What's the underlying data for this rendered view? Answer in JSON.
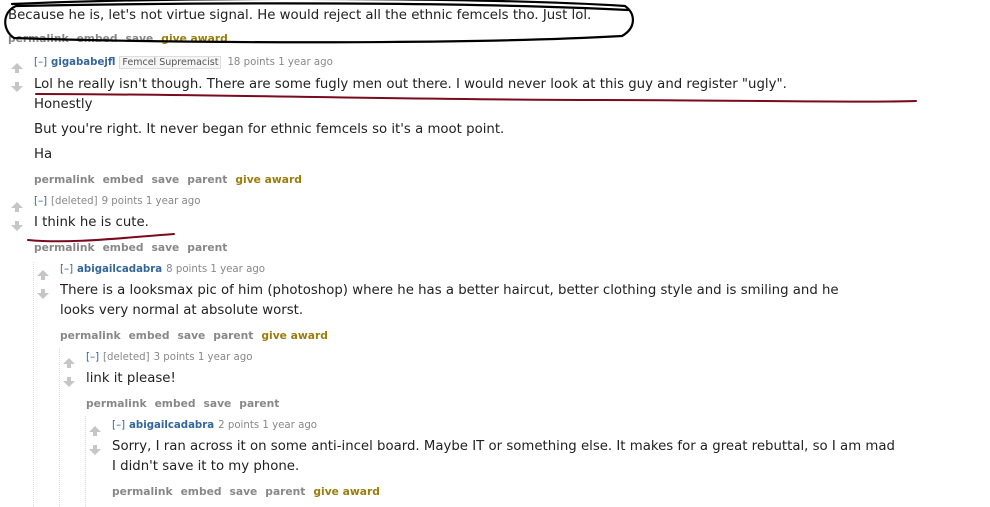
{
  "top_comment": {
    "text": "Because he is, let's not virtue signal. He would reject all the ethnic femcels tho. Just lol.",
    "buttons": [
      "permalink",
      "embed",
      "save",
      "give award"
    ]
  },
  "comments": [
    {
      "expand": "[–]",
      "author": "gigababejfl",
      "flair": "Femcel Supremacist",
      "points": "18 points",
      "time": "1 year ago",
      "lines": [
        "Lol he really isn't though. There are some fugly men out there. I would never look at this guy and register \"ugly\".",
        "Honestly",
        "But you're right. It never began for ethnic femcels so it's a moot point.",
        "Ha"
      ],
      "buttons": [
        "permalink",
        "embed",
        "save",
        "parent",
        "give award"
      ]
    },
    {
      "expand": "[–]",
      "author": "[deleted]",
      "points": "9 points",
      "time": "1 year ago",
      "lines": [
        "I think he is cute."
      ],
      "buttons": [
        "permalink",
        "embed",
        "save",
        "parent"
      ]
    },
    {
      "expand": "[–]",
      "author": "abigailcadabra",
      "points": "8 points",
      "time": "1 year ago",
      "lines": [
        "There is a looksmax pic of him (photoshop) where he has a better haircut, better clothing style and is smiling and he",
        "looks very normal at absolute worst."
      ],
      "buttons": [
        "permalink",
        "embed",
        "save",
        "parent",
        "give award"
      ]
    },
    {
      "expand": "[–]",
      "author": "[deleted]",
      "points": "3 points",
      "time": "1 year ago",
      "lines": [
        "link it please!"
      ],
      "buttons": [
        "permalink",
        "embed",
        "save",
        "parent"
      ]
    },
    {
      "expand": "[–]",
      "author": "abigailcadabra",
      "points": "2 points",
      "time": "1 year ago",
      "lines": [
        "Sorry, I ran across it on some anti-incel board. Maybe IT or something else. It makes for a great rebuttal, so I am mad",
        "I didn't save it to my phone."
      ],
      "buttons": [
        "permalink",
        "embed",
        "save",
        "parent",
        "give award"
      ]
    }
  ],
  "colors": {
    "author": "#336699",
    "award": "#9a7d0a",
    "muted": "#888888",
    "annotation_black": "#000000",
    "annotation_red": "#7a0a1e"
  }
}
